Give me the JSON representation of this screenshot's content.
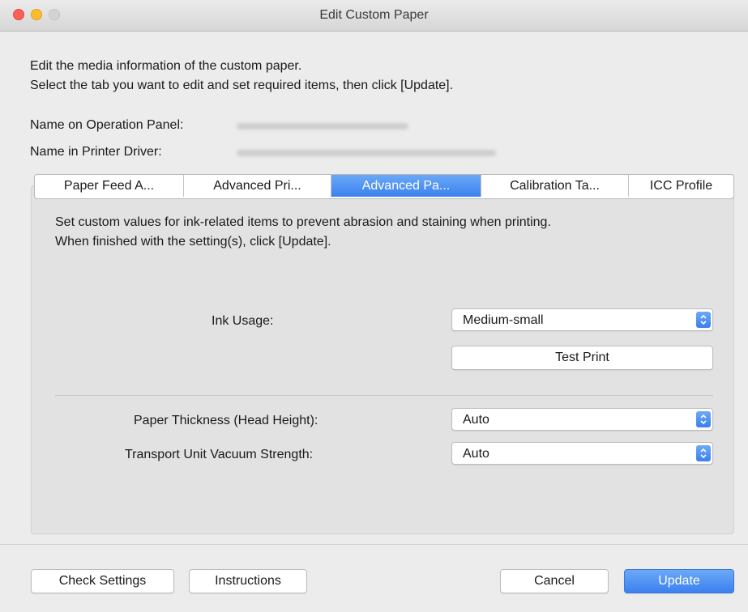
{
  "window": {
    "title": "Edit Custom Paper"
  },
  "intro": {
    "line1": "Edit the media information of the custom paper.",
    "line2": "Select the tab you want to edit and set required items, then click [Update]."
  },
  "names": {
    "operation_panel_label": "Name on Operation Panel:",
    "printer_driver_label": "Name in Printer Driver:"
  },
  "tabs": [
    {
      "label": "Paper Feed A..."
    },
    {
      "label": "Advanced Pri..."
    },
    {
      "label": "Advanced Pa..."
    },
    {
      "label": "Calibration Ta..."
    },
    {
      "label": "ICC Profile"
    }
  ],
  "panel": {
    "desc_line1": "Set custom values for ink-related items to prevent abrasion and staining when printing.",
    "desc_line2": "When finished with the setting(s), click [Update].",
    "ink_usage_label": "Ink Usage:",
    "ink_usage_value": "Medium-small",
    "test_print_label": "Test Print",
    "paper_thickness_label": "Paper Thickness (Head Height):",
    "paper_thickness_value": "Auto",
    "vacuum_label": "Transport Unit Vacuum Strength:",
    "vacuum_value": "Auto"
  },
  "footer": {
    "check_settings": "Check Settings",
    "instructions": "Instructions",
    "cancel": "Cancel",
    "update": "Update"
  },
  "colors": {
    "accent": "#3b82ef",
    "close": "#fc5f57",
    "minimize": "#fdbc2e",
    "maximize_disabled": "#d3d3d3"
  }
}
